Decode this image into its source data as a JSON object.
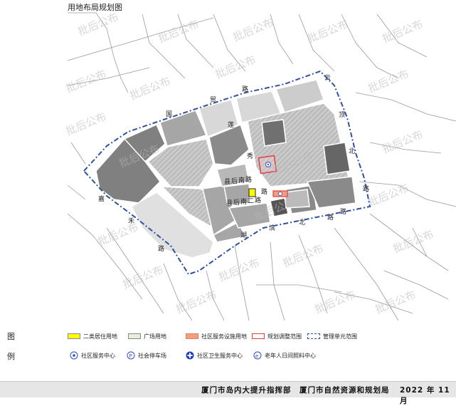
{
  "title": "用地布局规划图",
  "legend": {
    "title_chars": [
      "图",
      "例"
    ],
    "land_use": [
      {
        "label": "二类居住用地",
        "color": "#ffff00"
      },
      {
        "label": "广场用地",
        "color": "#e4efe0"
      },
      {
        "label": "社区服务设施用地",
        "color": "#f0a080"
      },
      {
        "label": "规划调整范围",
        "color": "#e04040"
      },
      {
        "label": "管理单元范围",
        "color": "#3050a0"
      }
    ],
    "facilities": [
      {
        "label": "社区服务中心",
        "icon": "community-service-center-icon",
        "color": "#3050c0"
      },
      {
        "label": "社会停车场",
        "icon": "parking-icon",
        "color": "#3050c0"
      },
      {
        "label": "社区卫生服务中心",
        "icon": "health-center-icon",
        "color": "#2040c0"
      },
      {
        "label": "老年人日间照料中心",
        "icon": "elderly-care-icon",
        "color": "#3050c0"
      }
    ]
  },
  "map": {
    "watermark": "批后公布",
    "roads": {
      "north": [
        "国",
        "贸",
        "路"
      ],
      "east": [
        "云",
        "顶",
        "北",
        "路"
      ],
      "south": [
        "湖",
        "滨",
        "北",
        "路"
      ],
      "west": [
        "嘉",
        "禾",
        "路"
      ],
      "inner": [
        "县",
        "后",
        "南",
        "路"
      ],
      "inner2": [
        "县",
        "后",
        "南",
        "二",
        "路"
      ],
      "vertical": [
        "莲",
        "秀",
        "路"
      ],
      "east_end": [
        "路"
      ]
    },
    "colors": {
      "boundary": "#3050a0",
      "adjust": "#e04040",
      "residential": "#ffff00",
      "community": "#f0a080",
      "plaza": "#e4efe0",
      "block_dark": "#808080",
      "block_mid": "#a6a6a6",
      "block_light": "#cccccc"
    }
  },
  "footer": {
    "org1": "厦门市岛内大提升指挥部",
    "org2": "厦门市自然资源和规划局",
    "date": "2022 年 11 月"
  }
}
